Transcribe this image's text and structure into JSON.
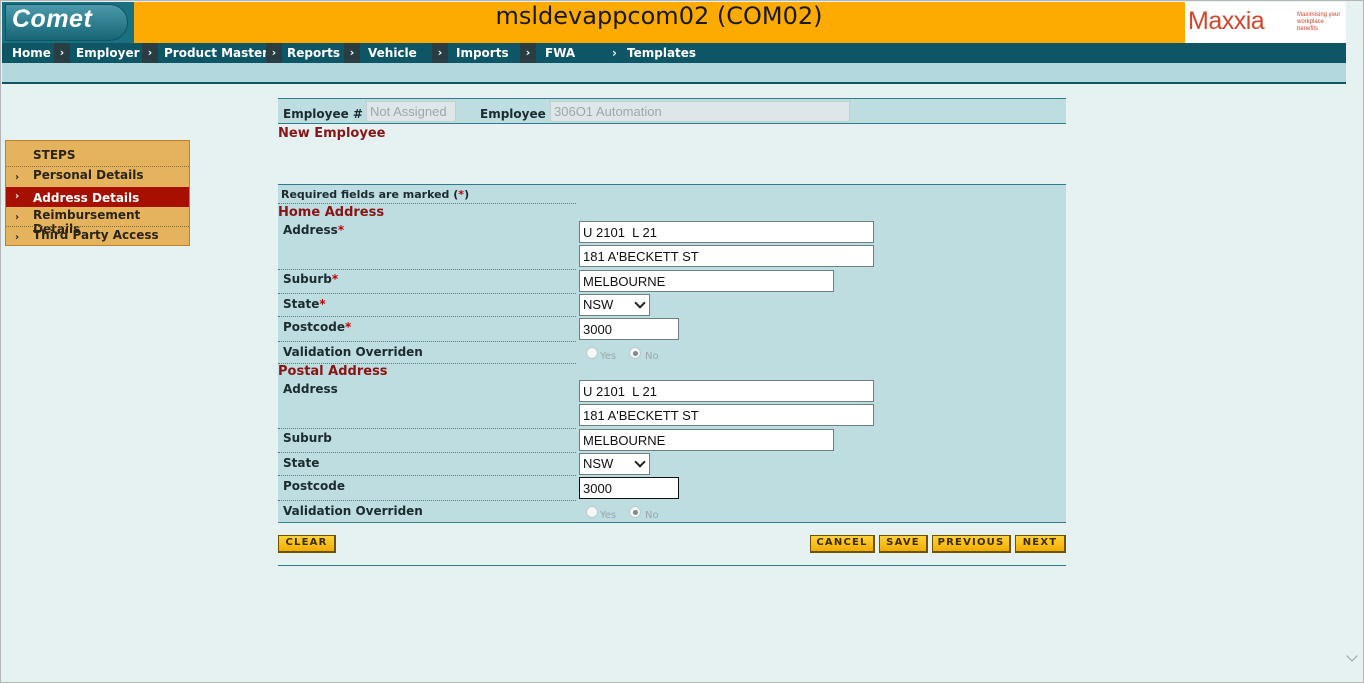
{
  "header": {
    "logo": "Comet",
    "title": "msldevappcom02 (COM02)",
    "brand": {
      "name": "Maxxia",
      "tagline": "Maximising your workplace benefits"
    }
  },
  "nav": [
    "Home",
    "Employer",
    "Product Master",
    "Reports",
    "Vehicle",
    "Imports",
    "FWA",
    "Templates"
  ],
  "steps": {
    "title": "STEPS",
    "items": [
      "Personal Details",
      "Address Details",
      "Reimbursement Details",
      "Third Party Access"
    ],
    "active": "Address Details"
  },
  "employee_bar": {
    "number_label": "Employee #",
    "number_value": "Not Assigned",
    "name_label": "Employee",
    "name_value": "306O1 Automation"
  },
  "page_heading": "New Employee",
  "form": {
    "required_note": "Required fields are marked (",
    "required_note_mark": "*",
    "required_note_end": ")",
    "home": {
      "heading": "Home Address",
      "address_label": "Address",
      "address_line1": "U 2101  L 21",
      "address_line2": "181 A'BECKETT ST",
      "suburb_label": "Suburb",
      "suburb": "MELBOURNE",
      "state_label": "State",
      "state": "NSW",
      "postcode_label": "Postcode",
      "postcode": "3000",
      "validation_label": "Validation Overriden",
      "yes": "Yes",
      "no": "No"
    },
    "postal": {
      "heading": "Postal Address",
      "address_label": "Address",
      "address_line1": "U 2101  L 21",
      "address_line2": "181 A'BECKETT ST",
      "suburb_label": "Suburb",
      "suburb": "MELBOURNE",
      "state_label": "State",
      "state": "NSW",
      "postcode_label": "Postcode",
      "postcode": "3000",
      "validation_label": "Validation Overriden",
      "yes": "Yes",
      "no": "No"
    },
    "required_mark": "*"
  },
  "buttons": {
    "clear": "CLEAR",
    "cancel": "CANCEL",
    "save": "SAVE",
    "previous": "PREVIOUS",
    "next": "NEXT"
  },
  "colors": {
    "header": "#fdab00",
    "nav": "#0e5566",
    "active_step": "#a70f00",
    "section_heading": "#8a1414"
  }
}
